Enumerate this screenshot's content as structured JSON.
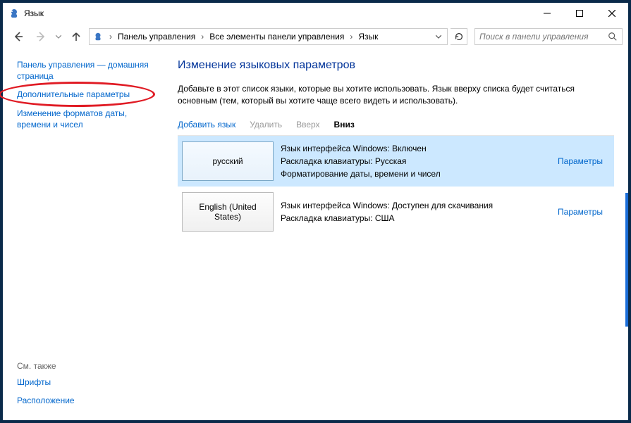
{
  "window": {
    "title": "Язык"
  },
  "breadcrumb": {
    "root": "Панель управления",
    "middle": "Все элементы панели управления",
    "leaf": "Язык"
  },
  "search": {
    "placeholder": "Поиск в панели управления"
  },
  "sidebar": {
    "home": "Панель управления — домашняя страница",
    "advanced": "Дополнительные параметры",
    "formats": "Изменение форматов даты, времени и чисел",
    "see_also_heading": "См. также",
    "fonts": "Шрифты",
    "location": "Расположение"
  },
  "main": {
    "heading": "Изменение языковых параметров",
    "description": "Добавьте в этот список языки, которые вы хотите использовать. Язык вверху списка будет считаться основным (тем, который вы хотите чаще всего видеть и использовать).",
    "toolbar": {
      "add": "Добавить язык",
      "remove": "Удалить",
      "up": "Вверх",
      "down": "Вниз"
    },
    "options_label": "Параметры",
    "languages": [
      {
        "tile": "русский",
        "line1": "Язык интерфейса Windows: Включен",
        "line2": "Раскладка клавиатуры: Русская",
        "line3": "Форматирование даты, времени и чисел"
      },
      {
        "tile": "English (United States)",
        "line1": "Язык интерфейса Windows: Доступен для скачивания",
        "line2": "Раскладка клавиатуры: США",
        "line3": ""
      }
    ]
  }
}
